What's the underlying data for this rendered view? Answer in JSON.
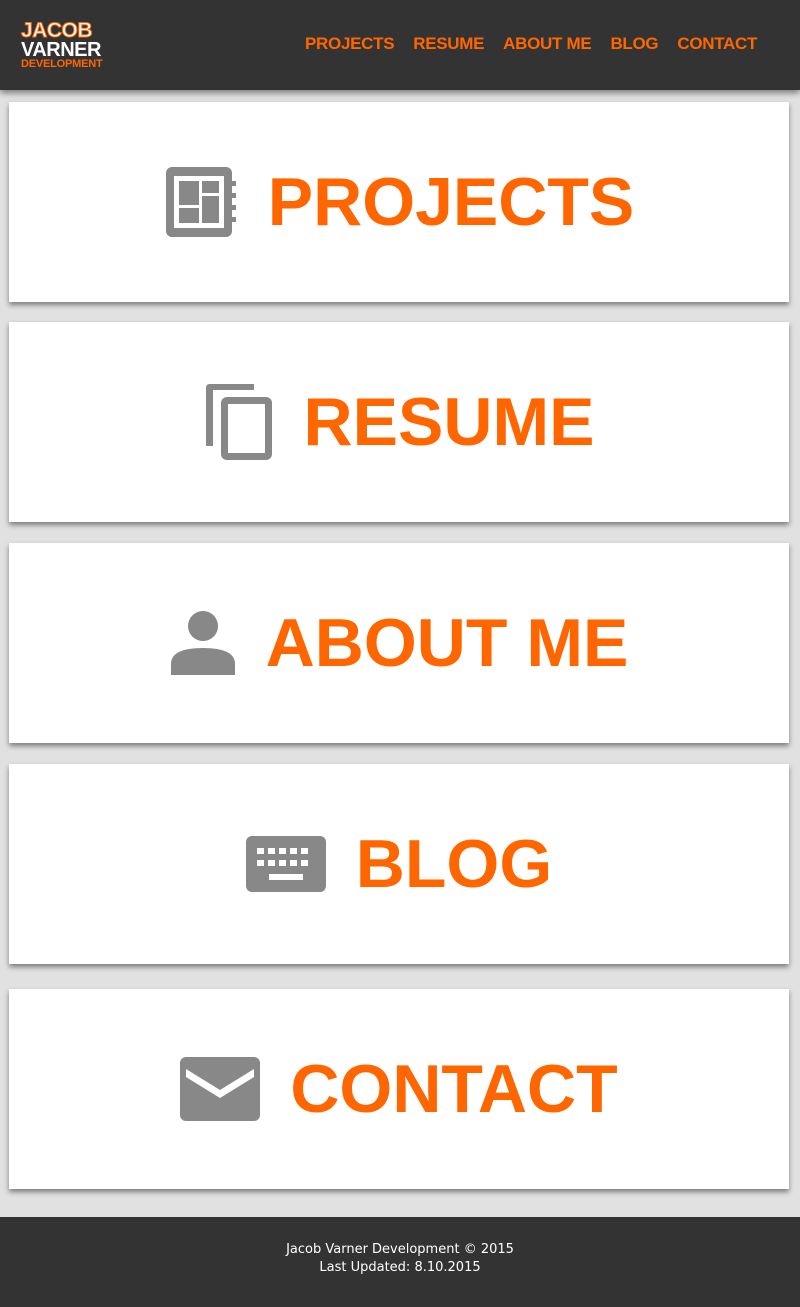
{
  "header": {
    "logo": {
      "line1": "JACOB",
      "line2": "VARNER",
      "line3": "DEVELOPMENT"
    },
    "nav": [
      "PROJECTS",
      "RESUME",
      "ABOUT ME",
      "BLOG",
      "CONTACT"
    ]
  },
  "cards": [
    {
      "label": "PROJECTS",
      "icon": "dashboard-icon"
    },
    {
      "label": "RESUME",
      "icon": "copy-documents-icon"
    },
    {
      "label": "ABOUT ME",
      "icon": "person-icon"
    },
    {
      "label": "BLOG",
      "icon": "keyboard-icon"
    },
    {
      "label": "CONTACT",
      "icon": "mail-icon"
    }
  ],
  "footer": {
    "line1": "Jacob Varner Development © 2015",
    "line2": "Last Updated: 8.10.2015"
  },
  "colors": {
    "accent": "#ff6600",
    "header_bg": "#333333",
    "icon_gray": "#888888",
    "page_bg": "#e1e1e1"
  }
}
